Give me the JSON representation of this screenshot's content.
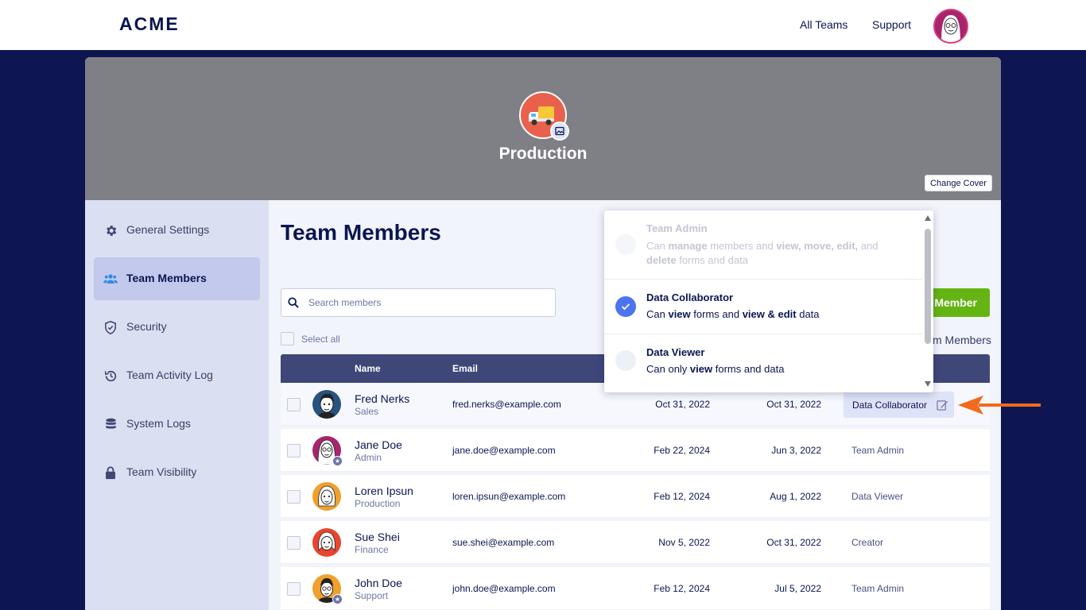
{
  "app": {
    "logo": "ACME",
    "nav": {
      "all_teams": "All Teams",
      "support": "Support"
    }
  },
  "cover": {
    "team_name": "Production",
    "change_cover": "Change Cover"
  },
  "sidebar": {
    "items": [
      {
        "label": "General Settings",
        "icon": "gear-icon"
      },
      {
        "label": "Team Members",
        "icon": "users-icon",
        "active": true
      },
      {
        "label": "Security",
        "icon": "shield-icon"
      },
      {
        "label": "Team Activity Log",
        "icon": "history-icon"
      },
      {
        "label": "System Logs",
        "icon": "database-icon"
      },
      {
        "label": "Team Visibility",
        "icon": "lock-icon"
      }
    ]
  },
  "main": {
    "title": "Team Members",
    "search_placeholder": "Search members",
    "select_all": "Select all",
    "add_button_partial": "Member",
    "members_link_partial": "m Members",
    "columns": {
      "name": "Name",
      "email": "Email"
    },
    "rows": [
      {
        "name": "Fred Nerks",
        "dept": "Sales",
        "email": "fred.nerks@example.com",
        "date1": "Oct 31, 2022",
        "date2": "Oct 31, 2022",
        "role": "Data Collaborator"
      },
      {
        "name": "Jane Doe",
        "dept": "Admin",
        "email": "jane.doe@example.com",
        "date1": "Feb 22, 2024",
        "date2": "Jun 3, 2022",
        "role": "Team Admin"
      },
      {
        "name": "Loren Ipsun",
        "dept": "Production",
        "email": "loren.ipsun@example.com",
        "date1": "Feb 12, 2024",
        "date2": "Aug 1, 2022",
        "role": "Data Viewer"
      },
      {
        "name": "Sue Shei",
        "dept": "Finance",
        "email": "sue.shei@example.com",
        "date1": "Nov 5, 2022",
        "date2": "Oct 31, 2022",
        "role": "Creator"
      },
      {
        "name": "John Doe",
        "dept": "Support",
        "email": "john.doe@example.com",
        "date1": "Feb 12, 2024",
        "date2": "Jul 5, 2022",
        "role": "Team Admin"
      }
    ]
  },
  "role_dropdown": {
    "options": [
      {
        "title": "Team Admin",
        "disabled": true
      },
      {
        "title": "Data Collaborator",
        "selected": true
      },
      {
        "title": "Data Viewer"
      }
    ],
    "desc_parts": {
      "admin": [
        "Can ",
        "manage",
        " members and ",
        "view, move, edit,",
        " and ",
        "delete",
        " forms and data"
      ],
      "collab": [
        "Can ",
        "view",
        " forms and ",
        "view & edit",
        " data"
      ],
      "viewer": [
        "Can only ",
        "view",
        " forms and data"
      ]
    }
  },
  "colors": {
    "navy": "#0a1551",
    "accent_green": "#64b413",
    "selected_blue": "#4c74f0",
    "annotation_arrow": "#f26a1b"
  }
}
